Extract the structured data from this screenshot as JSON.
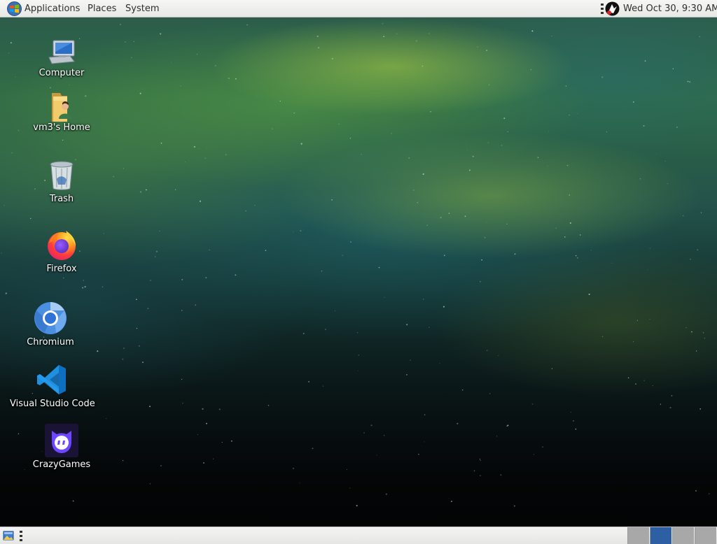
{
  "top_panel": {
    "applications_label": "Applications",
    "places_label": "Places",
    "system_label": "System",
    "clock": "Wed Oct 30,  9:30 AM"
  },
  "desktop": {
    "icons": [
      {
        "label": "Computer",
        "icon": "computer-icon"
      },
      {
        "label": "vm3's Home",
        "icon": "home-folder-icon"
      },
      {
        "label": "Trash",
        "icon": "trash-icon"
      },
      {
        "label": "Firefox",
        "icon": "firefox-icon"
      },
      {
        "label": "Chromium",
        "icon": "chromium-icon"
      },
      {
        "label": "Visual Studio Code",
        "icon": "vscode-icon"
      },
      {
        "label": "CrazyGames",
        "icon": "crazygames-icon"
      }
    ]
  },
  "bottom_panel": {
    "workspaces": [
      {
        "name": "workspace-1",
        "active": false
      },
      {
        "name": "workspace-2",
        "active": true
      },
      {
        "name": "workspace-3",
        "active": false
      },
      {
        "name": "workspace-4",
        "active": false
      }
    ]
  },
  "colors": {
    "panel_bg": "#eeeeec",
    "panel_text": "#2e2e2e",
    "active_workspace": "#2d5fa3",
    "inactive_workspace": "#a8a8a8",
    "desktop_label": "#ffffff"
  }
}
